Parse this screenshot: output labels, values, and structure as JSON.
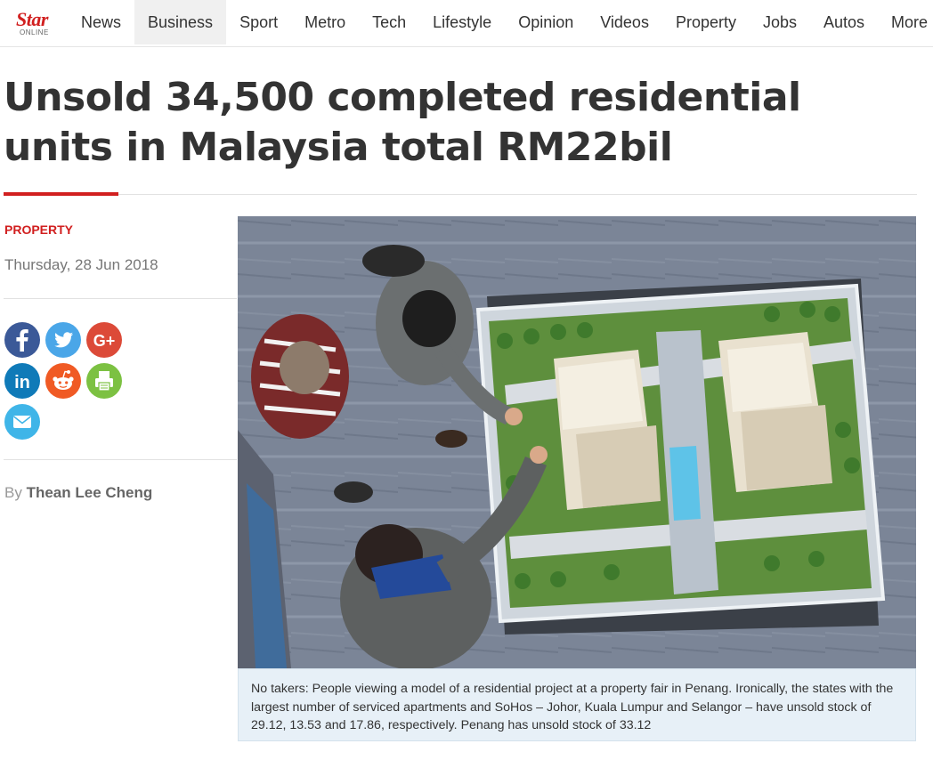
{
  "logo": {
    "wordmark": "Star",
    "sub": "ONLINE"
  },
  "nav": {
    "items": [
      "News",
      "Business",
      "Sport",
      "Metro",
      "Tech",
      "Lifestyle",
      "Opinion",
      "Videos",
      "Property",
      "Jobs",
      "Autos",
      "More"
    ],
    "active": "Business"
  },
  "article": {
    "headline": "Unsold 34,500 completed residential units in Malaysia total RM22bil",
    "category": "PROPERTY",
    "date": "Thursday, 28 Jun 2018",
    "byline_prefix": "By",
    "author": "Thean Lee Cheng",
    "caption": "No takers: People viewing a model of a residential project at a property fair in Penang. Ironically, the states with the largest number of serviced apartments and SoHos – Johor, Kuala Lumpur and Selangor – have unsold stock of 29.12, 13.53 and 17.86, respectively. Penang has unsold stock of 33.12"
  },
  "share": [
    {
      "icon": "facebook-icon",
      "color": "#3b5998"
    },
    {
      "icon": "twitter-icon",
      "color": "#4aa6e8"
    },
    {
      "icon": "google-plus-icon",
      "color": "#dc4a38"
    },
    {
      "icon": "linkedin-icon",
      "color": "#0f7ab8"
    },
    {
      "icon": "reddit-icon",
      "color": "#f05a24"
    },
    {
      "icon": "print-icon",
      "color": "#7cc142"
    },
    {
      "icon": "email-icon",
      "color": "#3fb5e8"
    }
  ],
  "colors": {
    "brand_red": "#d11f1f",
    "caption_bg": "#e7f0f7"
  }
}
